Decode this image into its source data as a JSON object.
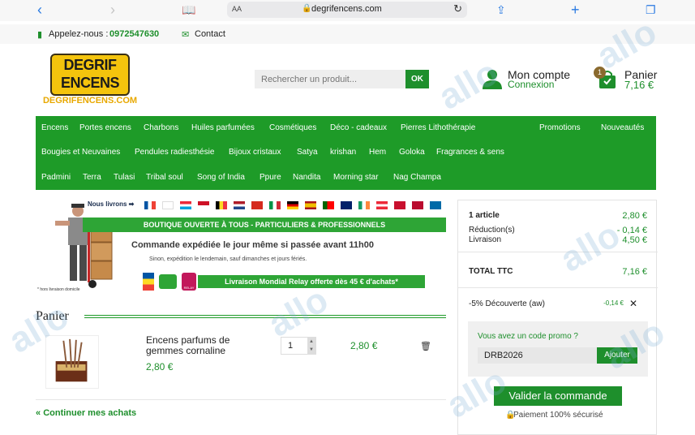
{
  "browser": {
    "url": "degrifencens.com",
    "text_size": "AA"
  },
  "topbar": {
    "phone_label": "Appelez-nous :",
    "phone_number": "0972547630",
    "contact_label": "Contact"
  },
  "logo": {
    "line1": "DEGRIF",
    "line2": "ENCENS",
    "domain": "DEGRIFENCENS.COM"
  },
  "search": {
    "placeholder": "Rechercher un produit...",
    "button": "OK"
  },
  "account": {
    "title": "Mon compte",
    "subtitle": "Connexion"
  },
  "cart": {
    "title": "Panier",
    "total": "7,16 €",
    "count": "1"
  },
  "menu": {
    "row1": [
      "Encens",
      "Portes encens",
      "Charbons",
      "Huiles parfumées",
      "Cosmétiques",
      "Déco - cadeaux",
      "Pierres Lithothérapie"
    ],
    "row1_right": [
      "Promotions",
      "Nouveautés"
    ],
    "row2": [
      "Bougies et Neuvaines",
      "Pendules radiesthésie",
      "Bijoux cristaux",
      "Satya",
      "krishan",
      "Hem",
      "Goloka",
      "Fragrances & sens"
    ],
    "row3": [
      "Padmini",
      "Terra",
      "Tulasi",
      "Tribal soul",
      "Song of India",
      "Ppure",
      "Nandita",
      "Morning star",
      "Nag Champa"
    ]
  },
  "banner": {
    "deliver_label": "Nous livrons ➡",
    "band": "BOUTIQUE OUVERTE À TOUS - PARTICULIERS & PROFESSIONNELS",
    "line1": "Commande expédiée le jour même si passée avant 11h00",
    "line2": "Sinon, expédition le lendemain, sauf dimanches et jours fériés.",
    "bottom": "Livraison Mondial Relay offerte dès 45 € d'achats*",
    "note": "* hors livraison domicile",
    "relay_label": "RELAY"
  },
  "panier": {
    "title": "Panier",
    "product_name": "Encens parfums de gemmes cornaline",
    "product_price": "2,80 €",
    "quantity": "1",
    "line_total": "2,80 €",
    "continue": "Continuer mes achats"
  },
  "summary": {
    "articles_label": "1 article",
    "articles_value": "2,80 €",
    "reduction_label": "Réduction(s)",
    "reduction_value": "- 0,14 €",
    "livraison_label": "Livraison",
    "livraison_value": "4,50 €",
    "total_label": "TOTAL TTC",
    "total_value": "7,16 €",
    "discount_label": "-5% Découverte (aw)",
    "discount_value": "-0,14 €",
    "promo_question": "Vous avez un code promo ?",
    "promo_code": "DRB2026",
    "promo_button": "Ajouter",
    "validate": "Valider la commande",
    "secure": "Paiement 100% sécurisé"
  },
  "colors": {
    "brand_green": "#1e9b28",
    "text_green": "#1e8f2c",
    "logo_yellow": "#f4c40d"
  }
}
